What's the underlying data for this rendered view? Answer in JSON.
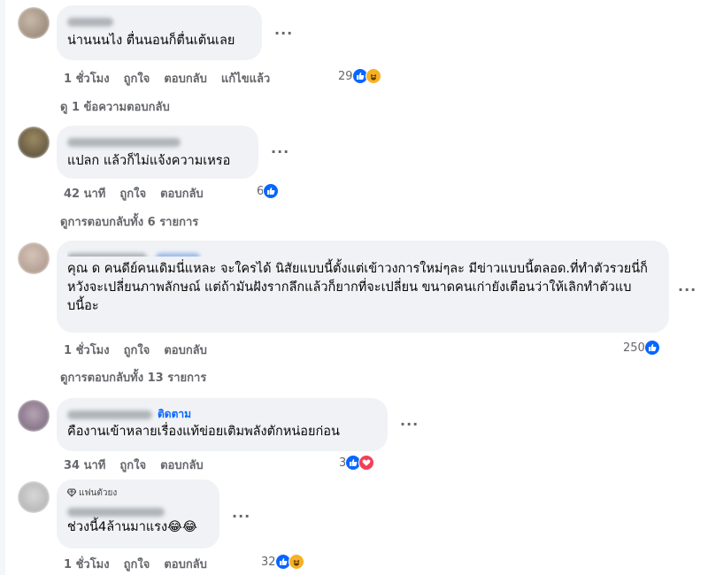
{
  "comments": [
    {
      "text": "น่านนนไง ตื่นนอนก็ตื่นเต้นเลย",
      "time": "1 ชั่วโมง",
      "like_label": "ถูกใจ",
      "reply_label": "ตอบกลับ",
      "edited_label": "แก้ไขแล้ว",
      "reaction_count": "29",
      "reactions": [
        "like-icon",
        "haha-icon"
      ],
      "replies_label": "ดู 1 ข้อความตอบกลับ"
    },
    {
      "text": "แปลก แล้วก็ไม่แจ้งความเหรอ",
      "time": "42 นาที",
      "like_label": "ถูกใจ",
      "reply_label": "ตอบกลับ",
      "reaction_count": "6",
      "reactions": [
        "like-icon"
      ],
      "replies_label": "ดูการตอบกลับทั้ง 6 รายการ"
    },
    {
      "text": "คุณ ด คนดีย์คนเดิมนี่แหละ จะใครได้ นิสัยแบบนี้ตั้งแต่เข้าวงการใหม่ๆละ มีข่าวแบบนี้ตลอด.ที่ทำตัวรวยนี่ก็หวังจะเปลี่ยนภาพลักษณ์ แต่ถ้ามันฝังรากลึกแล้วก็ยากที่จะเปลี่ยน ขนาดคนเก่ายังเตือนว่าให้เลิกทำตัวแบบนี้อะ",
      "time": "1 ชั่วโมง",
      "like_label": "ถูกใจ",
      "reply_label": "ตอบกลับ",
      "reaction_count": "250",
      "reactions": [
        "like-icon"
      ],
      "replies_label": "ดูการตอบกลับทั้ง 13 รายการ"
    },
    {
      "follow_label": "ติดตาม",
      "text": "คืองานเข้าหลายเรื่องแท้ข่อยเติมพลังตักหน่อยก่อน",
      "time": "34 นาที",
      "like_label": "ถูกใจ",
      "reply_label": "ตอบกลับ",
      "reaction_count": "3",
      "reactions": [
        "like-icon",
        "love-icon"
      ]
    },
    {
      "badge_label": "แฟนตัวยง",
      "text": "ช่วงนี้4ล้านมาแรง😂😂",
      "time": "1 ชั่วโมง",
      "like_label": "ถูกใจ",
      "reply_label": "ตอบกลับ",
      "reaction_count": "32",
      "reactions": [
        "like-icon",
        "haha-icon"
      ]
    }
  ],
  "colors": {
    "accent": "#0866ff",
    "muted": "#65676b",
    "bubble": "#f0f2f5",
    "love": "#f33e58",
    "haha": "#f7b125"
  }
}
